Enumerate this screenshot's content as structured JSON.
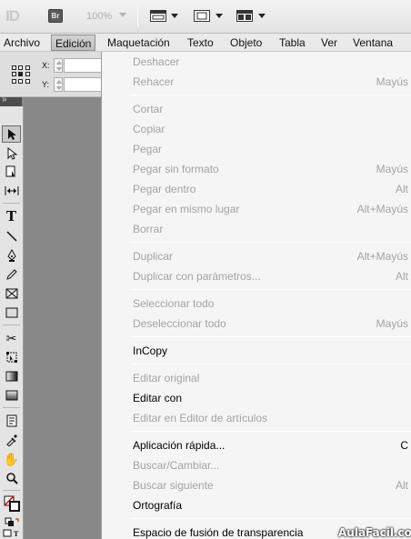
{
  "appbar": {
    "logo_text": "ID",
    "bridge_label": "Br",
    "zoom_level": "100%"
  },
  "menubar": {
    "items": [
      "Archivo",
      "Edición",
      "Maquetación",
      "Texto",
      "Objeto",
      "Tabla",
      "Ver",
      "Ventana"
    ],
    "active": "Edición"
  },
  "control_panel": {
    "x_label": "X:",
    "y_label": "Y:"
  },
  "tools_icons": [
    "selection-tool",
    "direct-selection-tool",
    "page-tool",
    "gap-tool",
    "type-tool",
    "line-tool",
    "pen-tool",
    "pencil-tool",
    "rectangle-frame-tool",
    "rectangle-tool",
    "scissors-tool",
    "free-transform-tool",
    "gradient-swatch-tool",
    "gradient-feather-tool",
    "note-tool",
    "eyedropper-tool",
    "hand-tool",
    "zoom-tool",
    "fill-stroke",
    "container-text"
  ],
  "edit_menu": {
    "items": [
      {
        "label": "Deshacer",
        "shortcut": "",
        "enabled": false
      },
      {
        "label": "Rehacer",
        "shortcut": "Mayús",
        "enabled": false
      },
      {
        "label": "Cortar",
        "shortcut": "",
        "enabled": false
      },
      {
        "label": "Copiar",
        "shortcut": "",
        "enabled": false
      },
      {
        "label": "Pegar",
        "shortcut": "",
        "enabled": false
      },
      {
        "label": "Pegar sin formato",
        "shortcut": "Mayús",
        "enabled": false
      },
      {
        "label": "Pegar dentro",
        "shortcut": "Alt",
        "enabled": false
      },
      {
        "label": "Pegar en mismo lugar",
        "shortcut": "Alt+Mayús",
        "enabled": false
      },
      {
        "label": "Borrar",
        "shortcut": "",
        "enabled": false
      },
      {
        "label": "Duplicar",
        "shortcut": "Alt+Mayús",
        "enabled": false
      },
      {
        "label": "Duplicar con parámetros...",
        "shortcut": "Alt",
        "enabled": false
      },
      {
        "label": "Seleccionar todo",
        "shortcut": "",
        "enabled": false
      },
      {
        "label": "Deseleccionar todo",
        "shortcut": "Mayús",
        "enabled": false
      },
      {
        "label": "InCopy",
        "shortcut": "",
        "enabled": true
      },
      {
        "label": "Editar original",
        "shortcut": "",
        "enabled": false
      },
      {
        "label": "Editar con",
        "shortcut": "",
        "enabled": true
      },
      {
        "label": "Editar en Editor de artículos",
        "shortcut": "",
        "enabled": false
      },
      {
        "label": "Aplicación rápida...",
        "shortcut": "C",
        "enabled": true
      },
      {
        "label": "Buscar/Cambiar...",
        "shortcut": "",
        "enabled": false
      },
      {
        "label": "Buscar siguiente",
        "shortcut": "Alt",
        "enabled": false
      },
      {
        "label": "Ortografía",
        "shortcut": "",
        "enabled": true
      },
      {
        "label": "Espacio de fusión de transparencia",
        "shortcut": "",
        "enabled": true
      }
    ]
  },
  "watermark": "AulaFacil.com"
}
